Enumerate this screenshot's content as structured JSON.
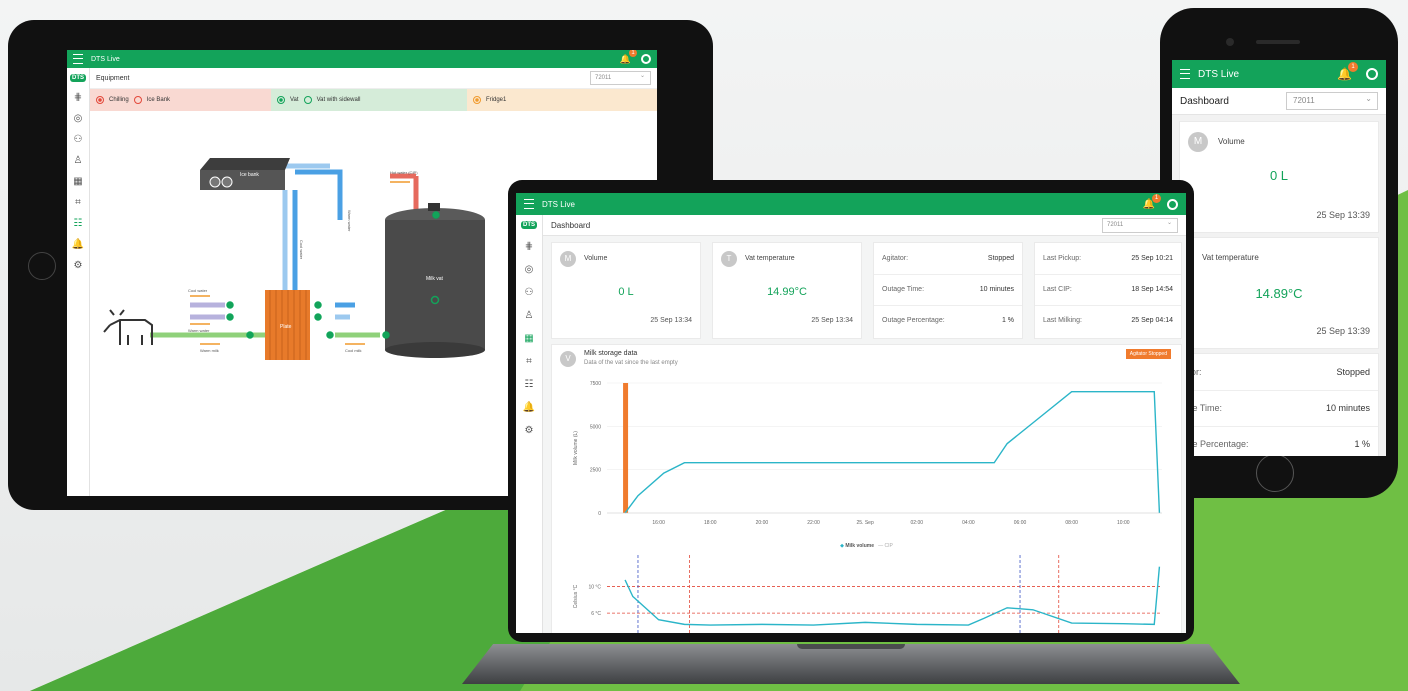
{
  "colors": {
    "brand_green": "#13a35a",
    "accent_orange": "#f07b2d",
    "chart_line": "#2bb5c8"
  },
  "app": {
    "name": "DTS Live",
    "notification_count": "1",
    "logo_text": "DTS"
  },
  "tablet": {
    "page_title": "Equipment",
    "site_id": "72011",
    "categories": [
      {
        "items": [
          "Chilling",
          "Ice Bank"
        ]
      },
      {
        "items": [
          "Vat",
          "Vat with sidewall"
        ]
      },
      {
        "items": [
          "Fridge1"
        ]
      }
    ],
    "diagram_labels": {
      "ice_bank": "Ice bank",
      "plate": "Plate",
      "milk_vat": "Milk vat",
      "hot_water": "Hot water (CIP)",
      "cool_water": "Cool water",
      "warm_water": "Warm water",
      "cool_water_in": "Cool water",
      "warm_water_out": "Warm water",
      "warm_milk": "Warm milk",
      "cool_milk": "Cool milk",
      "drain": "Drain"
    }
  },
  "laptop": {
    "page_title": "Dashboard",
    "site_id": "72011",
    "volume": {
      "avatar": "M",
      "label": "Volume",
      "value": "0 L",
      "timestamp": "25 Sep 13:34"
    },
    "temperature": {
      "avatar": "T",
      "label": "Vat temperature",
      "value": "14.99°C",
      "timestamp": "25 Sep 13:34"
    },
    "status": [
      {
        "key": "Agitator:",
        "value": "Stopped"
      },
      {
        "key": "Outage Time:",
        "value": "10 minutes"
      },
      {
        "key": "Outage Percentage:",
        "value": "1 %"
      }
    ],
    "events": [
      {
        "key": "Last Pickup:",
        "value": "25 Sep 10:21"
      },
      {
        "key": "Last CIP:",
        "value": "18 Sep 14:54"
      },
      {
        "key": "Last Milking:",
        "value": "25 Sep 04:14"
      }
    ],
    "storage": {
      "avatar": "V",
      "title": "Milk storage data",
      "subtitle": "Data of the vat since the last empty",
      "legend_badge": "Agitator Stopped",
      "legend_series": [
        "Milk volume",
        "CIP"
      ],
      "temp_ylabel": "Celsius °C"
    }
  },
  "phone": {
    "page_title": "Dashboard",
    "site_id": "72011",
    "volume": {
      "avatar": "M",
      "label": "Volume",
      "value": "0 L",
      "timestamp": "25 Sep 13:39"
    },
    "temperature": {
      "avatar": "T",
      "label": "Vat temperature",
      "value": "14.89°C",
      "timestamp": "25 Sep 13:39"
    },
    "status": [
      {
        "key": "Agitator:",
        "value": "Stopped"
      },
      {
        "key": "Outage Time:",
        "value": "10 minutes"
      },
      {
        "key": "Outage Percentage:",
        "value": "1 %"
      }
    ]
  },
  "chart_data": [
    {
      "type": "line",
      "title": "",
      "xlabel": "",
      "ylabel": "Milk volume (L)",
      "categories": [
        "16:00",
        "18:00",
        "20:00",
        "22:00",
        "25. Sep",
        "02:00",
        "04:00",
        "06:00",
        "08:00",
        "10:00"
      ],
      "yticks": [
        "0",
        "2500",
        "5000",
        "7500"
      ],
      "ylim": [
        0,
        7500
      ],
      "series": [
        {
          "name": "Milk volume",
          "x": [
            14.7,
            15.2,
            16.2,
            17.0,
            20,
            24,
            28,
            29.0,
            29.5,
            30.5,
            32,
            34,
            35.2,
            35.4
          ],
          "values": [
            0,
            1000,
            2300,
            2900,
            2900,
            2900,
            2900,
            2900,
            4000,
            5200,
            7000,
            7000,
            7000,
            0
          ]
        },
        {
          "name": "CIP",
          "x": [],
          "values": []
        }
      ],
      "highlight": {
        "label": "Agitator Stopped",
        "x": 14.7
      },
      "grid": true,
      "legend": "bottom-center"
    },
    {
      "type": "line",
      "title": "",
      "ylabel": "Celsius °C",
      "yticks": [
        "6 °C",
        "10 °C"
      ],
      "ylim": [
        3,
        14
      ],
      "thresholds": [
        6,
        10
      ],
      "series": [
        {
          "name": "Vat temperature",
          "x": [
            14.7,
            15,
            16,
            17,
            18,
            20,
            22,
            24,
            26,
            28,
            28.6,
            29.5,
            30.5,
            32,
            34,
            35.2,
            35.4
          ],
          "values": [
            11,
            8.5,
            5,
            4.3,
            4.2,
            4.3,
            4.2,
            4.6,
            4.3,
            4.2,
            5.2,
            6.8,
            6.5,
            4.5,
            4.4,
            4.3,
            13
          ]
        }
      ]
    }
  ]
}
